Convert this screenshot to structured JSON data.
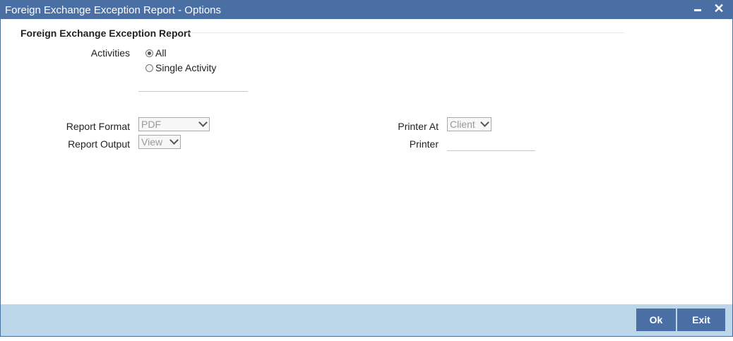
{
  "window": {
    "title": "Foreign Exchange Exception Report - Options",
    "close_glyph": "✕"
  },
  "section": {
    "title": "Foreign Exchange Exception Report"
  },
  "activities": {
    "label": "Activities",
    "options": [
      {
        "label": "All",
        "selected": true
      },
      {
        "label": "Single Activity",
        "selected": false
      }
    ],
    "activity_value": ""
  },
  "report": {
    "format_label": "Report Format",
    "format_value": "PDF",
    "output_label": "Report Output",
    "output_value": "View"
  },
  "printer": {
    "at_label": "Printer At",
    "at_value": "Client",
    "printer_label": "Printer",
    "printer_value": ""
  },
  "footer": {
    "ok_label": "Ok",
    "exit_label": "Exit"
  },
  "colors": {
    "titlebar": "#4a6fa5",
    "footer": "#bcd7ea",
    "button": "#4a6fa5"
  }
}
